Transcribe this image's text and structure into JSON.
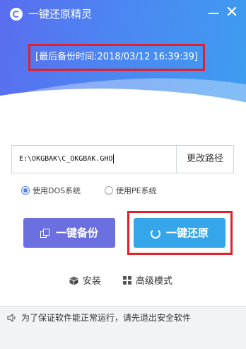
{
  "window": {
    "title": "一键还原精灵",
    "minimize_label": "—",
    "close_label": "✕"
  },
  "header": {
    "last_backup": "[最后备份时间:2018/03/12 16:39:39]"
  },
  "path": {
    "value": "E:\\OKGBAK\\C_OKGBAK.GHO",
    "change_button": "更改路径"
  },
  "mode": {
    "options": [
      "使用DOS系统",
      "使用PE系统"
    ],
    "selected": "使用DOS系统"
  },
  "actions": {
    "backup_label": "一键备份",
    "restore_label": "一键还原"
  },
  "links": {
    "install_label": "安装",
    "advanced_label": "高级模式"
  },
  "footer": {
    "message": "为了保证软件能正常运行，请先退出安全软件"
  },
  "colors": {
    "header_start": "#5a6df0",
    "header_end": "#3e9df0",
    "backup_button": "#6b6fe0",
    "restore_button": "#36a6ea",
    "highlight_frame": "#e0212b"
  },
  "icons": {
    "logo": "app-logo-icon",
    "backup": "copy-icon",
    "restore": "restore-icon",
    "install": "cube-icon",
    "advanced": "grid-icon",
    "footer": "speaker-icon"
  }
}
